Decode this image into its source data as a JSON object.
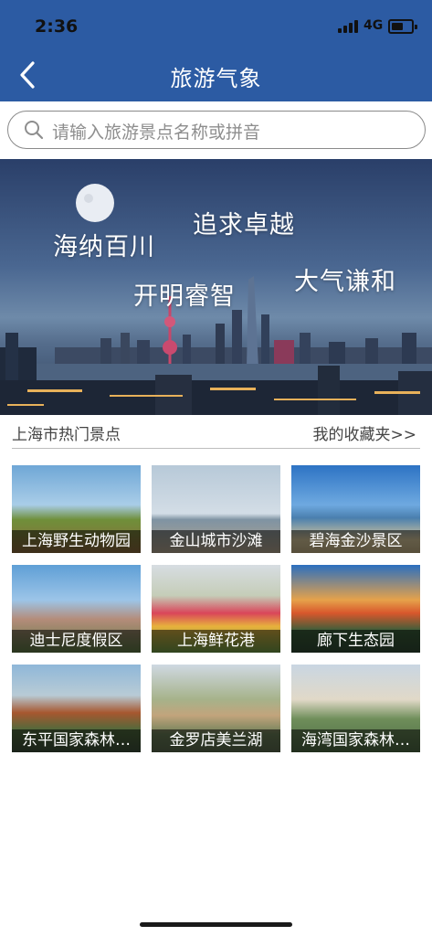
{
  "status_bar": {
    "time": "2:36",
    "network": "4G"
  },
  "nav": {
    "title": "旅游气象"
  },
  "search": {
    "placeholder": "请输入旅游景点名称或拼音"
  },
  "banner": {
    "slogans": [
      "海纳百川",
      "追求卓越",
      "开明睿智",
      "大气谦和"
    ]
  },
  "section": {
    "title": "上海市热门景点",
    "favorites_link": "我的收藏夹>>"
  },
  "spots": [
    "上海野生动物园",
    "金山城市沙滩",
    "碧海金沙景区",
    "迪士尼度假区",
    "上海鲜花港",
    "廊下生态园",
    "东平国家森林…",
    "金罗店美兰湖",
    "海湾国家森林…"
  ],
  "colors": {
    "nav_bar": "#2c5ba3",
    "section_text": "#444444"
  }
}
